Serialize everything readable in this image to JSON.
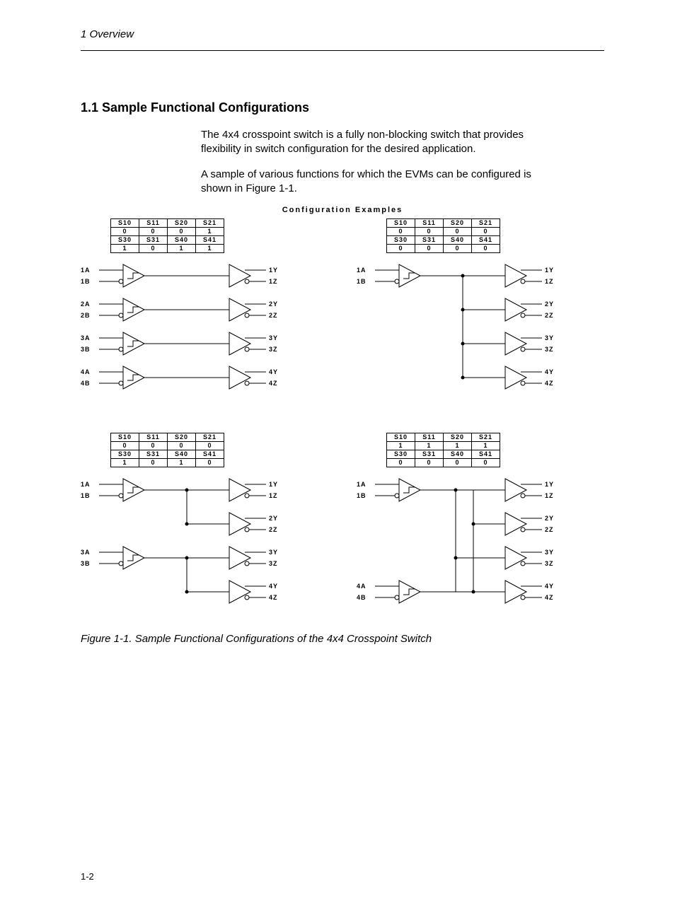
{
  "header": "1  Overview",
  "section_heading": "1.1   Sample Functional Configurations",
  "para1": "The 4x4 crosspoint switch is a fully non-blocking switch that provides flexibility in switch configuration for the desired application.",
  "para2": "A sample of various functions for which the EVMs can be configured is shown in Figure 1-1.",
  "figure_heading": "Configuration Examples",
  "figure_caption": "Figure 1-1. Sample Functional Configurations of the 4x4 Crosspoint Switch",
  "page_number": "1-2",
  "signal_headers_top": [
    "S10",
    "S11",
    "S20",
    "S21"
  ],
  "signal_headers_bot": [
    "S30",
    "S31",
    "S40",
    "S41"
  ],
  "configs": [
    {
      "r1": [
        "0",
        "0",
        "0",
        "1"
      ],
      "r2": [
        "1",
        "0",
        "1",
        "1"
      ],
      "in_labels": [
        "1A",
        "1B",
        "2A",
        "2B",
        "3A",
        "3B",
        "4A",
        "4B"
      ],
      "out_labels": [
        "1Y",
        "1Z",
        "2Y",
        "2Z",
        "3Y",
        "3Z",
        "4Y",
        "4Z"
      ],
      "inputs_shown": [
        0,
        1,
        2,
        3
      ],
      "routing": "one_to_one"
    },
    {
      "r1": [
        "0",
        "0",
        "0",
        "0"
      ],
      "r2": [
        "0",
        "0",
        "0",
        "0"
      ],
      "in_labels": [
        "1A",
        "1B"
      ],
      "out_labels": [
        "1Y",
        "1Z",
        "2Y",
        "2Z",
        "3Y",
        "3Z",
        "4Y",
        "4Z"
      ],
      "inputs_shown": [
        0
      ],
      "routing": "fanout_one"
    },
    {
      "r1": [
        "0",
        "0",
        "0",
        "0"
      ],
      "r2": [
        "1",
        "0",
        "1",
        "0"
      ],
      "in_labels": [
        "1A",
        "1B",
        "3A",
        "3B"
      ],
      "out_labels": [
        "1Y",
        "1Z",
        "2Y",
        "2Z",
        "3Y",
        "3Z",
        "4Y",
        "4Z"
      ],
      "inputs_shown": [
        0,
        2
      ],
      "routing": "fanout_two"
    },
    {
      "r1": [
        "1",
        "1",
        "1",
        "1"
      ],
      "r2": [
        "0",
        "0",
        "0",
        "0"
      ],
      "in_labels": [
        "1A",
        "1B",
        "4A",
        "4B"
      ],
      "out_labels": [
        "1Y",
        "1Z",
        "2Y",
        "2Z",
        "3Y",
        "3Z",
        "4Y",
        "4Z"
      ],
      "inputs_shown": [
        0,
        3
      ],
      "routing": "cross_two"
    }
  ]
}
